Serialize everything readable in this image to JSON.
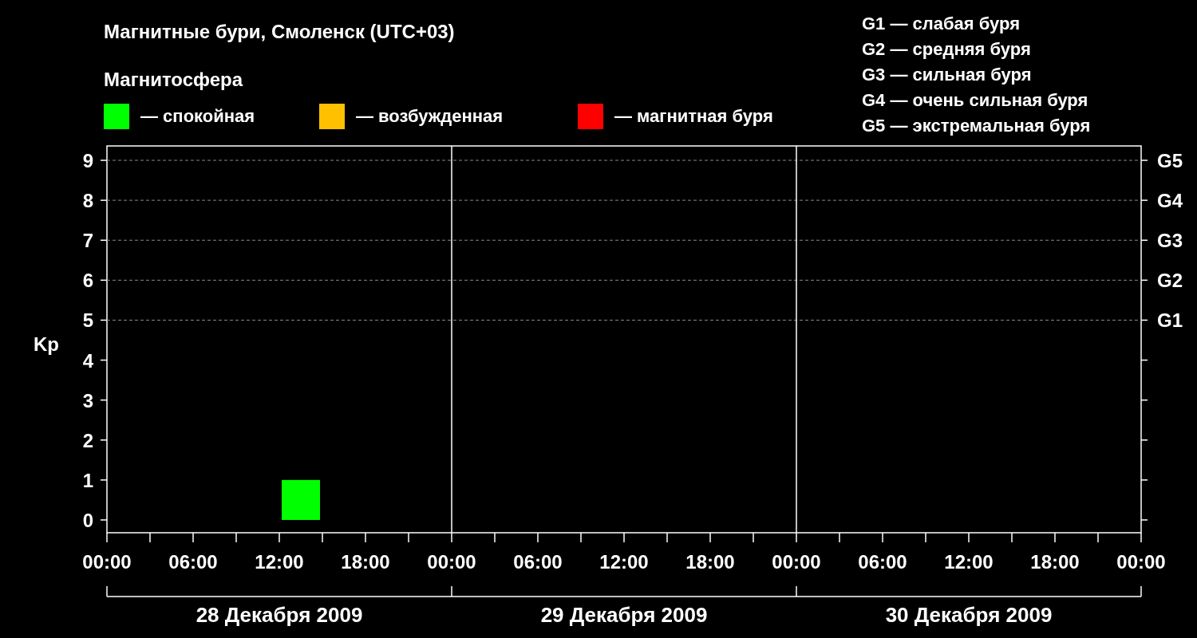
{
  "title": "Магнитные бури, Смоленск (UTC+03)",
  "legend": {
    "heading": "Магнитосфера"
  },
  "g_scale": [
    "G1 — слабая буря",
    "G2 — средняя буря",
    "G3 — сильная буря",
    "G4 — очень сильная буря",
    "G5 — экстремальная буря"
  ],
  "chart": {
    "chart_data": {
      "type": "bar",
      "ylabel": "Kp",
      "ylim": [
        -0.32,
        9.36
      ],
      "grid": true,
      "categories": [
        "00:00",
        "06:00",
        "12:00",
        "18:00",
        "00:00",
        "06:00",
        "12:00",
        "18:00",
        "00:00",
        "06:00",
        "12:00",
        "18:00",
        "00:00"
      ],
      "series": [
        {
          "name": "— спокойная",
          "color": "#00ff00",
          "values": [
            null,
            null,
            1,
            null,
            null,
            null,
            null,
            null,
            null,
            null,
            null,
            null,
            null
          ]
        },
        {
          "name": "— возбужденная",
          "color": "#ffc000",
          "values": [
            null,
            null,
            null,
            null,
            null,
            null,
            null,
            null,
            null,
            null,
            null,
            null,
            null
          ]
        },
        {
          "name": "— магнитная буря",
          "color": "#ff0000",
          "values": [
            null,
            null,
            null,
            null,
            null,
            null,
            null,
            null,
            null,
            null,
            null,
            null,
            null
          ]
        }
      ],
      "yticks": [
        0,
        1,
        2,
        3,
        4,
        5,
        6,
        7,
        8,
        9
      ]
    },
    "g_labels": [
      "G5",
      "G4",
      "G3",
      "G2",
      "G1"
    ],
    "days": [
      "28 Декабря 2009",
      "29 Декабря 2009",
      "30 Декабря 2009"
    ]
  }
}
